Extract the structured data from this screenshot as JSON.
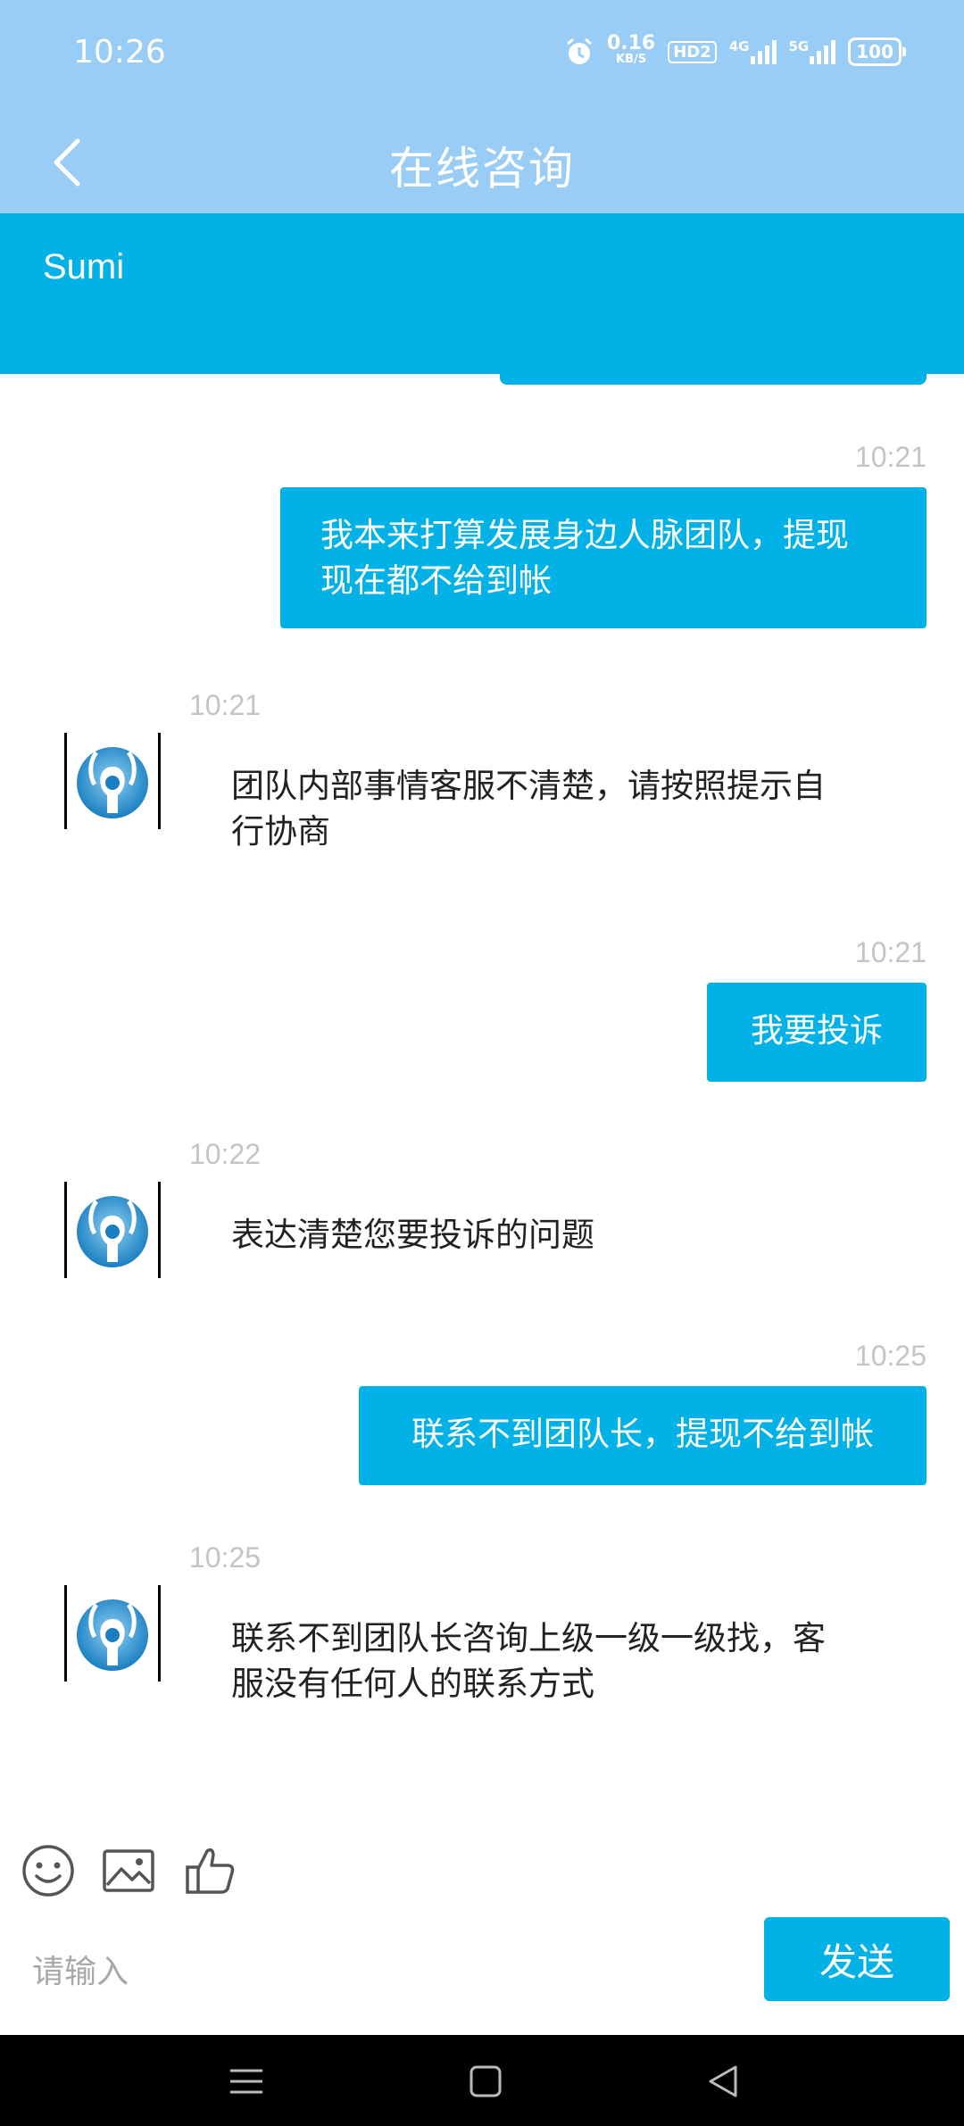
{
  "status_bar": {
    "time": "10:26",
    "net_speed": "0.16",
    "net_unit": "KB/S",
    "hd_label": "HD2",
    "network_4g": "4G",
    "network_5g": "5G",
    "battery": "100"
  },
  "title_bar": {
    "title": "在线咨询"
  },
  "agent": {
    "name": "Sumi"
  },
  "messages": [
    {
      "time": "10:21",
      "direction": "out",
      "line1": "我本来打算发展身边人脉团队，提现",
      "line2": "现在都不给到帐"
    },
    {
      "time": "10:21",
      "direction": "in",
      "line1": "团队内部事情客服不清楚，请按照提示自",
      "line2": "行协商"
    },
    {
      "time": "10:21",
      "direction": "out",
      "line1": "我要投诉"
    },
    {
      "time": "10:22",
      "direction": "in",
      "line1": "表达清楚您要投诉的问题"
    },
    {
      "time": "10:25",
      "direction": "out",
      "line1": "联系不到团队长，提现不给到帐"
    },
    {
      "time": "10:25",
      "direction": "in",
      "line1": "联系不到团队长咨询上级一级一级找，客",
      "line2": "服没有任何人的联系方式"
    }
  ],
  "input": {
    "placeholder": "请输入",
    "value": "",
    "send_label": "发送"
  },
  "colors": {
    "accent": "#02b2e6",
    "top_bar": "#99cdf5",
    "timestamp": "#c4c4c4"
  }
}
